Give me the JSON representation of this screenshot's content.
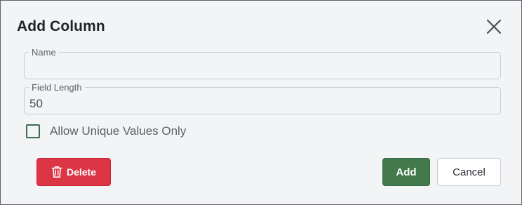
{
  "dialog": {
    "title": "Add Column",
    "close_icon": "close-icon"
  },
  "fields": {
    "name": {
      "label": "Name",
      "value": ""
    },
    "field_length": {
      "label": "Field Length",
      "value": "50"
    }
  },
  "checkbox": {
    "label": "Allow Unique Values Only",
    "checked": false
  },
  "buttons": {
    "delete_label": "Delete",
    "delete_icon": "trash-icon",
    "add_label": "Add",
    "cancel_label": "Cancel"
  },
  "colors": {
    "delete": "#dc3545",
    "add": "#447a4b",
    "checkbox_border": "#3e6b4a"
  }
}
